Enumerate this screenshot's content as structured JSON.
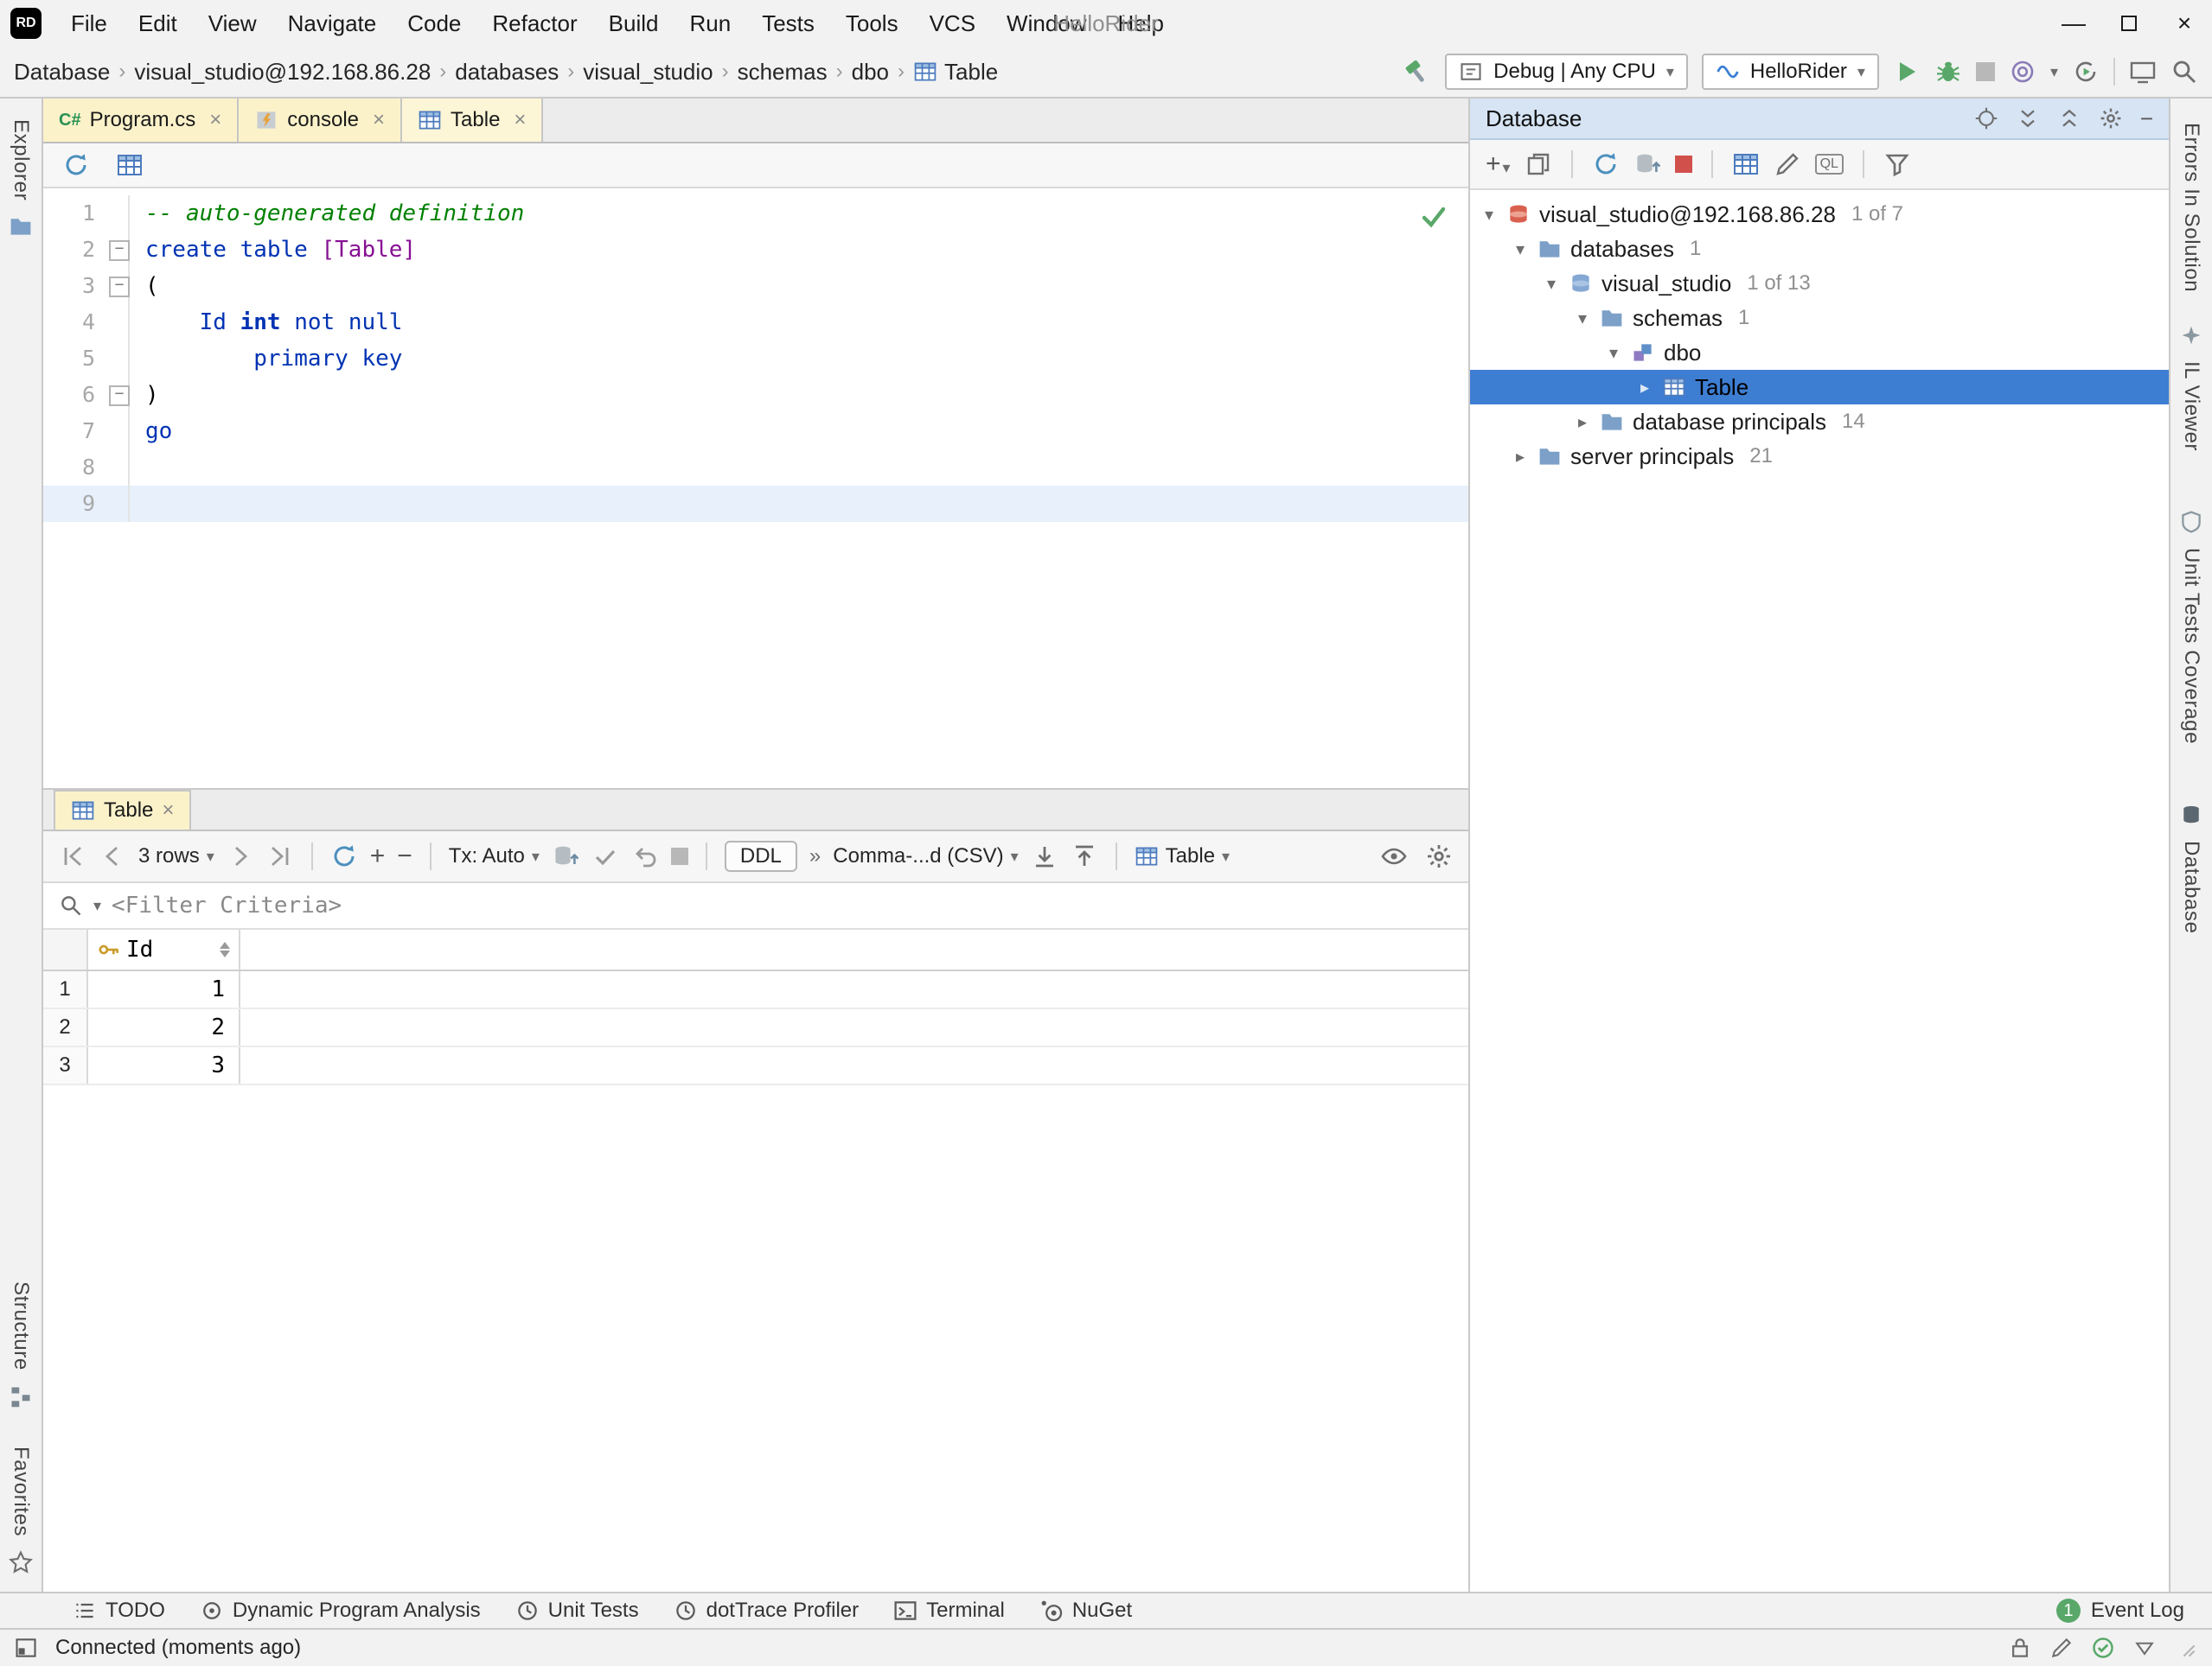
{
  "colors": {
    "selection_blue": "#3e7ed2",
    "tab_cream": "#fbf2ca",
    "green": "#59a869",
    "red": "#d1504c"
  },
  "menubar": {
    "logo": "RD",
    "items": [
      "File",
      "Edit",
      "View",
      "Navigate",
      "Code",
      "Refactor",
      "Build",
      "Run",
      "Tests",
      "Tools",
      "VCS",
      "Window",
      "Help"
    ],
    "window_title": "HelloRider"
  },
  "toolbar": {
    "breadcrumbs": [
      "Database",
      "visual_studio@192.168.86.28",
      "databases",
      "visual_studio",
      "schemas",
      "dbo",
      "Table"
    ],
    "config_selector": "Debug | Any CPU",
    "run_selector": "HelloRider"
  },
  "left_strip": {
    "explorer": "Explorer",
    "structure": "Structure",
    "favorites": "Favorites"
  },
  "right_strip": {
    "errors": "Errors In Solution",
    "il_viewer": "IL Viewer",
    "coverage": "Unit Tests Coverage",
    "database": "Database"
  },
  "editor": {
    "tabs": [
      {
        "badge": "C#",
        "label": "Program.cs"
      },
      {
        "label": "console"
      },
      {
        "label": "Table",
        "active": true
      }
    ],
    "code": {
      "lines": [
        {
          "n": 1,
          "tokens": [
            {
              "t": "-- auto-generated definition",
              "s": "comment"
            }
          ]
        },
        {
          "n": 2,
          "fold": true,
          "tokens": [
            {
              "t": "create table ",
              "s": "kw"
            },
            {
              "t": "[Table]",
              "s": "ident"
            }
          ]
        },
        {
          "n": 3,
          "fold": true,
          "tokens": [
            {
              "t": "(",
              "s": "plain"
            }
          ]
        },
        {
          "n": 4,
          "tokens": [
            {
              "t": "    ",
              "s": "plain"
            },
            {
              "t": "Id",
              "s": "kw"
            },
            {
              "t": " ",
              "s": "plain"
            },
            {
              "t": "int",
              "s": "type"
            },
            {
              "t": " ",
              "s": "plain"
            },
            {
              "t": "not null",
              "s": "kw"
            }
          ]
        },
        {
          "n": 5,
          "tokens": [
            {
              "t": "        ",
              "s": "plain"
            },
            {
              "t": "primary key",
              "s": "kw"
            }
          ]
        },
        {
          "n": 6,
          "fold": true,
          "tokens": [
            {
              "t": ")",
              "s": "plain"
            }
          ]
        },
        {
          "n": 7,
          "tokens": [
            {
              "t": "go",
              "s": "kw"
            }
          ]
        },
        {
          "n": 8,
          "tokens": []
        },
        {
          "n": 9,
          "caret": true,
          "tokens": []
        }
      ]
    }
  },
  "table_panel": {
    "tab": {
      "label": "Table"
    },
    "toolbar": {
      "rows_selector": "3 rows",
      "tx_selector": "Tx: Auto",
      "ddl_button": "DDL",
      "format_selector": "Comma-...d (CSV)",
      "view_selector": "Table"
    },
    "filter_placeholder": "<Filter Criteria>",
    "grid": {
      "columns": [
        {
          "name": "Id",
          "key": true
        }
      ],
      "rows": [
        {
          "num": "1",
          "values": [
            "1"
          ]
        },
        {
          "num": "2",
          "values": [
            "2"
          ]
        },
        {
          "num": "3",
          "values": [
            "3"
          ]
        }
      ]
    }
  },
  "database_panel": {
    "title": "Database",
    "tree": [
      {
        "level": 0,
        "expanded": true,
        "icon": "sqlserver",
        "label": "visual_studio@192.168.86.28",
        "count": "1 of 7"
      },
      {
        "level": 1,
        "expanded": true,
        "icon": "folder",
        "label": "databases",
        "count": "1"
      },
      {
        "level": 2,
        "expanded": true,
        "icon": "database",
        "label": "visual_studio",
        "count": "1 of 13"
      },
      {
        "level": 3,
        "expanded": true,
        "icon": "folder",
        "label": "schemas",
        "count": "1"
      },
      {
        "level": 4,
        "expanded": true,
        "icon": "schema",
        "label": "dbo",
        "count": ""
      },
      {
        "level": 5,
        "expanded": false,
        "icon": "table",
        "label": "Table",
        "count": "",
        "selected": true
      },
      {
        "level": 3,
        "expanded": false,
        "icon": "folder",
        "label": "database principals",
        "count": "14"
      },
      {
        "level": 1,
        "expanded": false,
        "icon": "folder",
        "label": "server principals",
        "count": "21"
      }
    ]
  },
  "bottom_bar": {
    "buttons": [
      "TODO",
      "Dynamic Program Analysis",
      "Unit Tests",
      "dotTrace Profiler",
      "Terminal",
      "NuGet"
    ],
    "event_log": {
      "badge": "1",
      "label": "Event Log"
    }
  },
  "status_bar": {
    "message": "Connected (moments ago)"
  }
}
